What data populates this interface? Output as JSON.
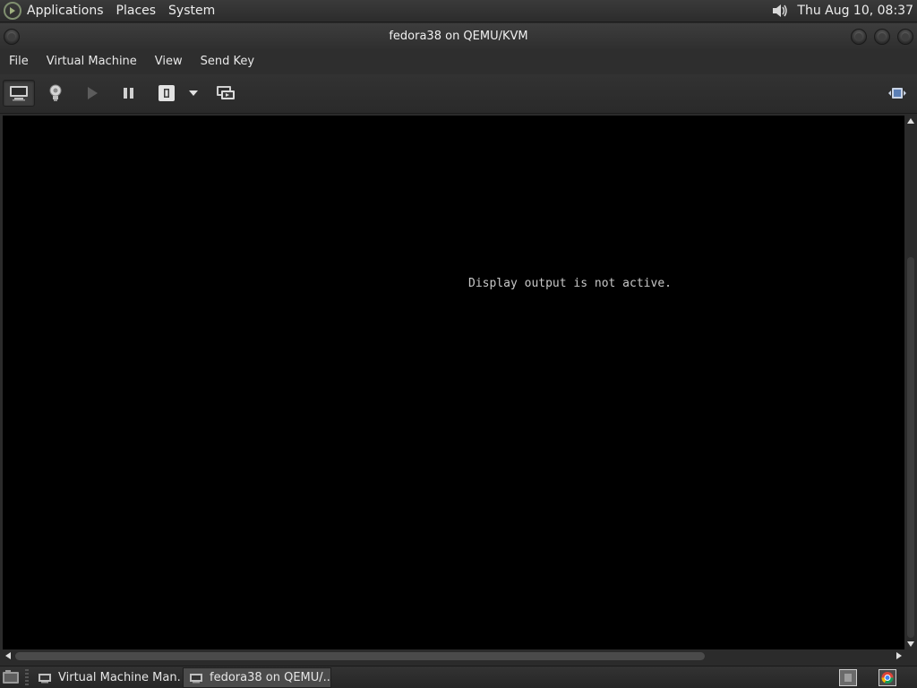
{
  "top_panel": {
    "menu": [
      "Applications",
      "Places",
      "System"
    ],
    "clock": "Thu Aug 10, 08:37",
    "icons": [
      "fedora-logo",
      "speaker-icon"
    ]
  },
  "window": {
    "title": "fedora38 on QEMU/KVM",
    "menubar": [
      "File",
      "Virtual Machine",
      "View",
      "Send Key"
    ]
  },
  "toolbar": {
    "buttons": [
      "console-icon",
      "info-lightbulb-icon",
      "run-icon",
      "pause-icon",
      "shutdown-icon",
      "dropdown-arrow-icon",
      "snapshots-icon",
      "fullscreen-icon"
    ]
  },
  "display": {
    "message": "Display output is not active."
  },
  "taskbar": {
    "tasks": [
      {
        "label": "Virtual Machine Man...",
        "active": false
      },
      {
        "label": "fedora38 on QEMU/...",
        "active": true
      }
    ]
  },
  "colors": {
    "panel_bg": "#2c2c2c",
    "display_bg": "#000000",
    "text": "#e6e6e6"
  }
}
